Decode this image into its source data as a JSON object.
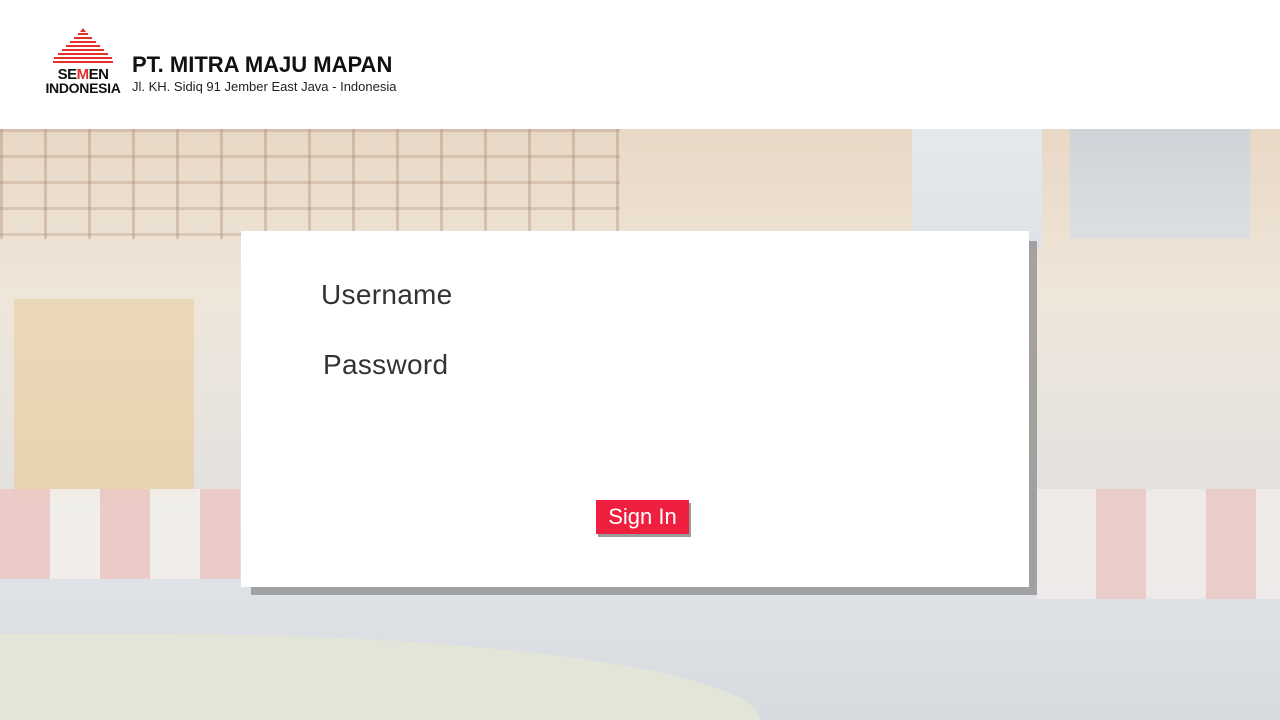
{
  "header": {
    "logo": {
      "word_top_pre": "SE",
      "word_top_mark": "M",
      "word_top_post": "EN",
      "word_bottom": "INDONESIA"
    },
    "company_name": "PT. MITRA MAJU MAPAN",
    "company_address": "Jl. KH. Sidiq 91 Jember East Java - Indonesia"
  },
  "login": {
    "username_label": "Username",
    "password_label": "Password",
    "username_value": "",
    "password_value": "",
    "signin_label": "Sign In"
  },
  "colors": {
    "accent": "#ef1f3f",
    "logo_red": "#e0312d"
  }
}
